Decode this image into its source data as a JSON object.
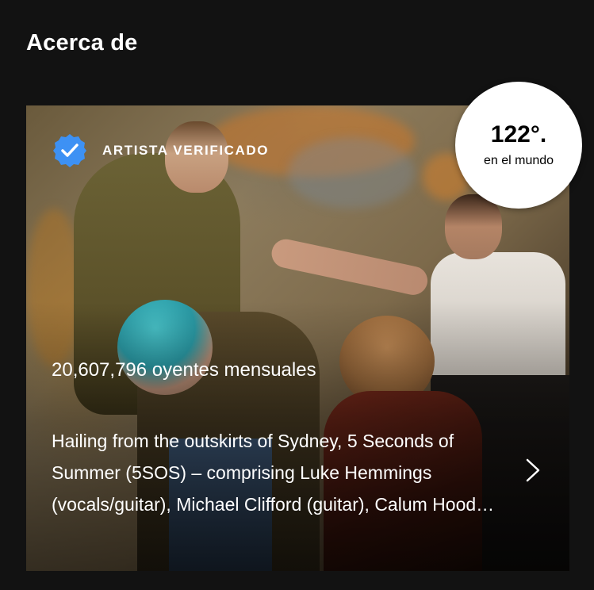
{
  "section": {
    "title": "Acerca de"
  },
  "about_card": {
    "verified_label": "ARTISTA VERIFICADO",
    "monthly_listeners": "20,607,796 oyentes mensuales",
    "bio": "Hailing from the outskirts of Sydney, 5 Seconds of Summer (5SOS) – comprising Luke Hemmings (vocals/guitar), Michael Clifford (guitar), Calum Hood (bass) and Ashton Irwin (drums)...",
    "verified_icon": "verified-badge-icon",
    "chevron_icon": "chevron-right-icon"
  },
  "rank": {
    "value": "122°.",
    "label": "en el mundo"
  },
  "colors": {
    "background": "#121212",
    "verified_blue": "#3d91f4",
    "text": "#ffffff"
  }
}
